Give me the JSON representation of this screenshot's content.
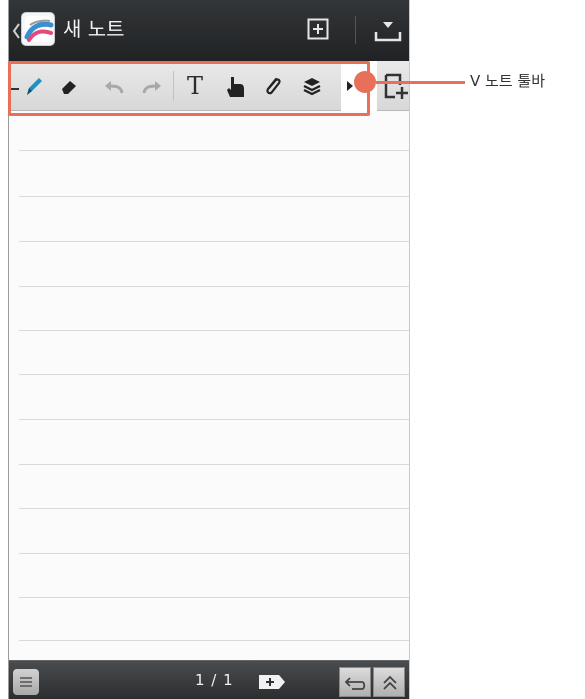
{
  "topbar": {
    "title": "새 노트",
    "icons": [
      "back-chevron-icon",
      "app-icon",
      "insert-page-icon",
      "save-icon"
    ]
  },
  "toolbar": {
    "tools": [
      "pen-icon",
      "eraser-icon",
      "undo-icon",
      "redo-icon",
      "text-tool",
      "hand-icon",
      "attach-icon",
      "layers-icon",
      "collapse-arrow-icon",
      "add-page-icon"
    ],
    "text_tool_label": "T"
  },
  "bottombar": {
    "page_indicator": "1 / 1",
    "buttons": [
      "menu-icon",
      "new-page-icon",
      "return-icon",
      "scroll-up-icon"
    ]
  },
  "annotation": {
    "label": "V 노트 툴바"
  },
  "colors": {
    "highlight": "#e8705a",
    "topbar": "#2a2c2e",
    "pen_accent": "#1f8fc4"
  }
}
